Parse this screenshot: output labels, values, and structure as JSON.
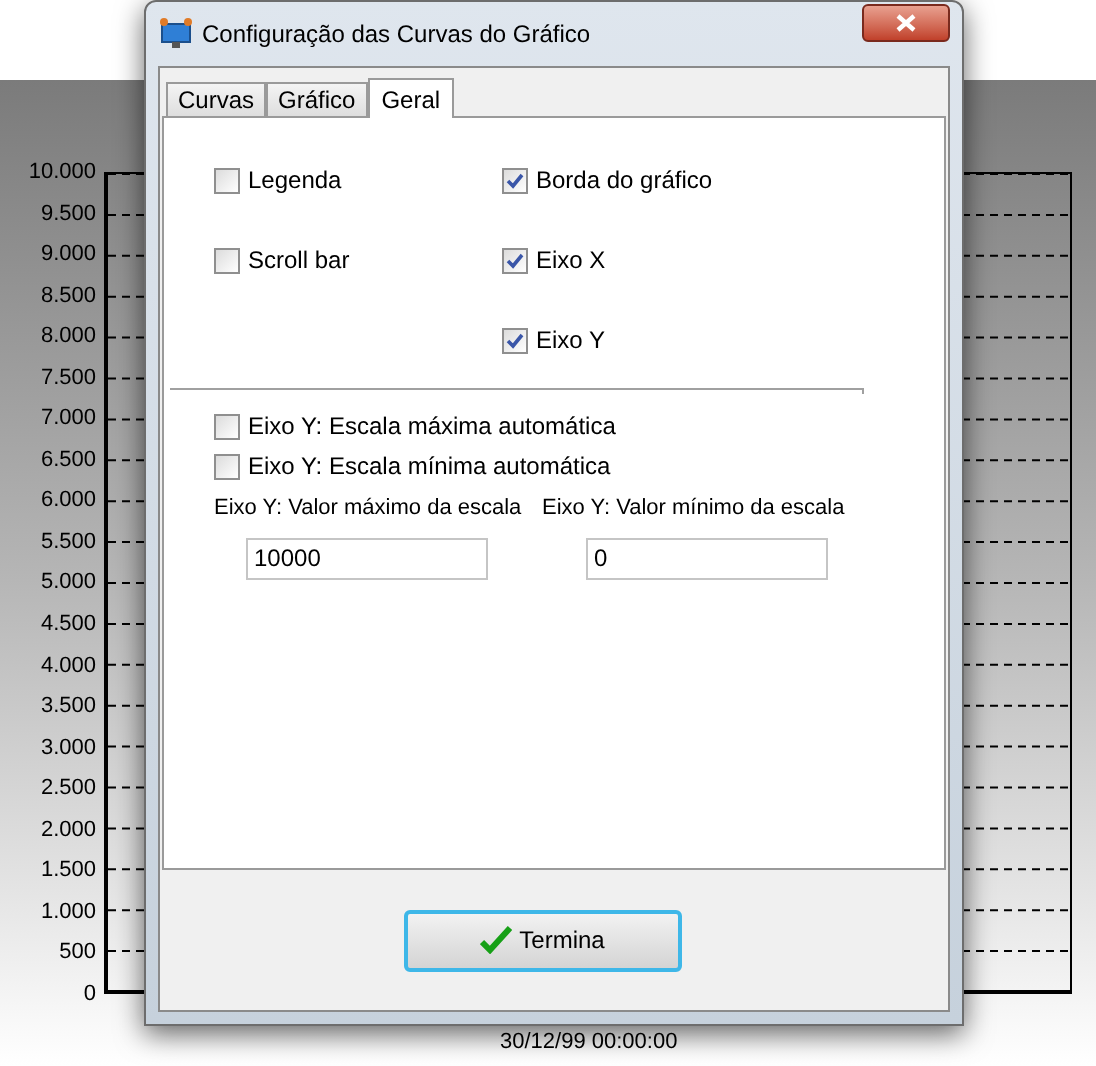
{
  "background_chart": {
    "y_labels": [
      "10.000",
      "9.500",
      "9.000",
      "8.500",
      "8.000",
      "7.500",
      "7.000",
      "6.500",
      "6.000",
      "5.500",
      "5.000",
      "4.500",
      "4.000",
      "3.500",
      "3.000",
      "2.500",
      "2.000",
      "1.500",
      "1.000",
      "500",
      "0"
    ],
    "x_label": "30/12/99 00:00:00"
  },
  "window": {
    "title": "Configuração das Curvas do Gráfico"
  },
  "tabs": [
    {
      "label": "Curvas",
      "selected": false
    },
    {
      "label": "Gráfico",
      "selected": false
    },
    {
      "label": "Geral",
      "selected": true
    }
  ],
  "left_options": [
    {
      "label": "Legenda",
      "checked": false
    },
    {
      "label": "Scroll bar",
      "checked": false
    }
  ],
  "right_options": [
    {
      "label": "Borda do gráfico",
      "checked": true
    },
    {
      "label": "Eixo X",
      "checked": true
    },
    {
      "label": "Eixo Y",
      "checked": true
    }
  ],
  "auto_scale": [
    {
      "label": "Eixo Y: Escala máxima automática",
      "checked": false
    },
    {
      "label": "Eixo Y: Escala mínima automática",
      "checked": false
    }
  ],
  "fields": [
    {
      "label": "Eixo Y: Valor máximo da escala",
      "value": "10000"
    },
    {
      "label": "Eixo Y: Valor mínimo da escala",
      "value": "0"
    }
  ],
  "buttons": [
    {
      "label": "Termina"
    }
  ]
}
